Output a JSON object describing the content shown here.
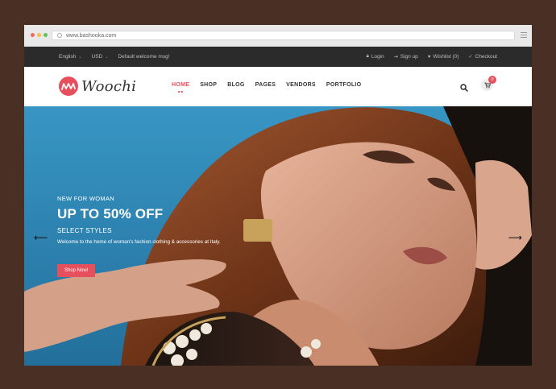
{
  "browser": {
    "url": "www.bashooka.com"
  },
  "topbar": {
    "language": "English",
    "currency": "USD",
    "welcome": "Default welcome msg!",
    "login": "Login",
    "signup": "Sign up",
    "wishlist": "Wishlist (0)",
    "checkout": "Checkout"
  },
  "header": {
    "logo_text": "Woochi",
    "nav": [
      "HOME",
      "SHOP",
      "BLOG",
      "PAGES",
      "VENDORS",
      "PORTFOLIO"
    ],
    "cart_count": "0"
  },
  "hero": {
    "eyebrow": "NEW FOR WOMAN",
    "headline": "UP TO 50% OFF",
    "subline": "SELECT STYLES",
    "description": "Welcome to the home of woman's fashion clothing & accessories at Italy.",
    "cta_label": "Shop Now!",
    "prev_arrow": "⟵",
    "next_arrow": "⟶"
  },
  "colors": {
    "accent": "#e6505c",
    "topbar_bg": "#2b2b2b",
    "page_bg": "#4a2f24",
    "hero_bg": "#2f88b5"
  },
  "icons": [
    "search-icon",
    "cart-icon",
    "lock-icon",
    "user-icon",
    "heart-icon",
    "check-icon",
    "menu-icon"
  ]
}
